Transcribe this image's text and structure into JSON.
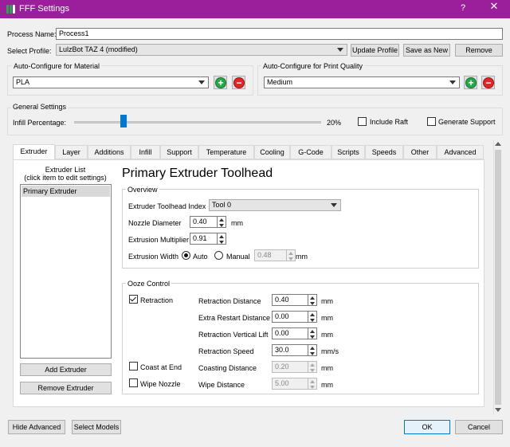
{
  "window": {
    "title": "FFF Settings",
    "help": "?",
    "close": "✕"
  },
  "process": {
    "label": "Process Name:",
    "value": "Process1"
  },
  "profile": {
    "label": "Select Profile:",
    "value": "LulzBot TAZ 4 (modified)",
    "update_btn": "Update Profile",
    "save_btn": "Save as New",
    "remove_btn": "Remove"
  },
  "material": {
    "title": "Auto-Configure for Material",
    "value": "PLA"
  },
  "quality": {
    "title": "Auto-Configure for Print Quality",
    "value": "Medium"
  },
  "general": {
    "title": "General Settings",
    "infill_label": "Infill Percentage:",
    "infill_value": "20%",
    "infill_fraction": 0.2,
    "raft_label": "Include Raft",
    "support_label": "Generate Support"
  },
  "tabs": [
    "Extruder",
    "Layer",
    "Additions",
    "Infill",
    "Support",
    "Temperature",
    "Cooling",
    "G-Code",
    "Scripts",
    "Speeds",
    "Other",
    "Advanced"
  ],
  "extruder_list": {
    "title_line1": "Extruder List",
    "title_line2": "(click item to edit settings)",
    "items": [
      "Primary Extruder"
    ],
    "add_btn": "Add Extruder",
    "remove_btn": "Remove Extruder"
  },
  "heading": "Primary Extruder Toolhead",
  "overview": {
    "title": "Overview",
    "toolhead_label": "Extruder Toolhead Index",
    "toolhead_value": "Tool 0",
    "nozzle_label": "Nozzle Diameter",
    "nozzle_value": "0.40",
    "nozzle_unit": "mm",
    "multiplier_label": "Extrusion Multiplier",
    "multiplier_value": "0.91",
    "width_label": "Extrusion Width",
    "auto_label": "Auto",
    "manual_label": "Manual",
    "width_value": "0.48",
    "width_unit": "mm"
  },
  "ooze": {
    "title": "Ooze Control",
    "retraction_label": "Retraction",
    "coast_label": "Coast at End",
    "wipe_label": "Wipe Nozzle",
    "rows": [
      {
        "label": "Retraction Distance",
        "value": "0.40",
        "unit": "mm"
      },
      {
        "label": "Extra Restart Distance",
        "value": "0.00",
        "unit": "mm"
      },
      {
        "label": "Retraction Vertical Lift",
        "value": "0.00",
        "unit": "mm"
      },
      {
        "label": "Retraction Speed",
        "value": "30.0",
        "unit": "mm/s"
      },
      {
        "label": "Coasting Distance",
        "value": "0.20",
        "unit": "mm"
      },
      {
        "label": "Wipe Distance",
        "value": "5.00",
        "unit": "mm"
      }
    ]
  },
  "footer": {
    "hide_btn": "Hide Advanced",
    "models_btn": "Select Models",
    "ok_btn": "OK",
    "cancel_btn": "Cancel"
  },
  "colors": {
    "titlebar": "#9b1f9b",
    "accent": "#0078d7",
    "add_green": "#2aa64c",
    "remove_red": "#e0262b"
  }
}
